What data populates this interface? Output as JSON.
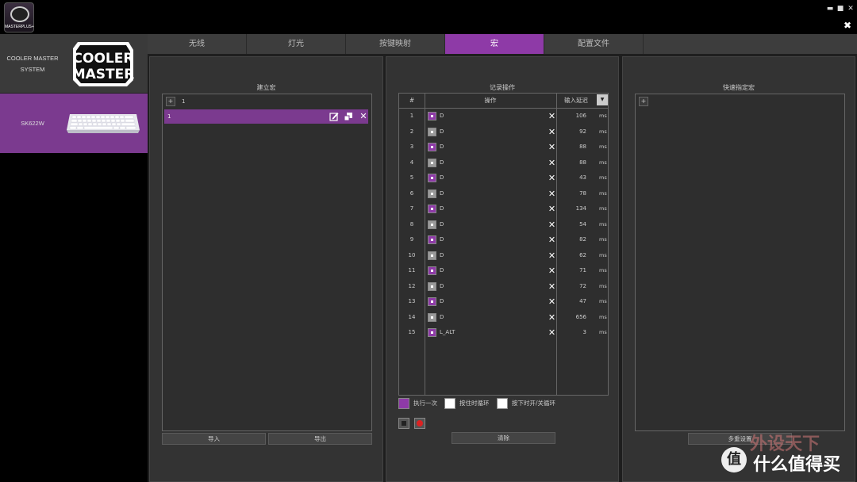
{
  "app": {
    "logo_label": "MASTERPLUS+"
  },
  "window_controls": {
    "minimize": "▬",
    "maximize": "■",
    "close": "✕"
  },
  "sidebar": {
    "devices": [
      {
        "label": "COOLER MASTER SYSTEM",
        "logo_text_1": "COOLER",
        "logo_text_2": "MASTER"
      },
      {
        "label": "SK622W"
      }
    ]
  },
  "tabs": [
    {
      "label": "无线"
    },
    {
      "label": "灯光"
    },
    {
      "label": "按键映射"
    },
    {
      "label": "宏",
      "active": true
    },
    {
      "label": "配置文件"
    }
  ],
  "build_macro": {
    "title": "建立宏",
    "add_label": "+",
    "header_value": "1",
    "macros": [
      {
        "name": "1"
      }
    ],
    "import_label": "导入",
    "export_label": "导出"
  },
  "record": {
    "title": "记录操作",
    "col_num": "#",
    "col_action": "操作",
    "col_delay": "输入延迟",
    "dropdown_icon": "▼",
    "unit": "ms",
    "rows": [
      {
        "n": "1",
        "state": "down",
        "key": "D",
        "delay": "106"
      },
      {
        "n": "2",
        "state": "up",
        "key": "D",
        "delay": "92"
      },
      {
        "n": "3",
        "state": "down",
        "key": "D",
        "delay": "88"
      },
      {
        "n": "4",
        "state": "up",
        "key": "D",
        "delay": "88"
      },
      {
        "n": "5",
        "state": "down",
        "key": "D",
        "delay": "43"
      },
      {
        "n": "6",
        "state": "up",
        "key": "D",
        "delay": "78"
      },
      {
        "n": "7",
        "state": "down",
        "key": "D",
        "delay": "134"
      },
      {
        "n": "8",
        "state": "up",
        "key": "D",
        "delay": "54"
      },
      {
        "n": "9",
        "state": "down",
        "key": "D",
        "delay": "82"
      },
      {
        "n": "10",
        "state": "up",
        "key": "D",
        "delay": "62"
      },
      {
        "n": "11",
        "state": "down",
        "key": "D",
        "delay": "71"
      },
      {
        "n": "12",
        "state": "up",
        "key": "D",
        "delay": "72"
      },
      {
        "n": "13",
        "state": "down",
        "key": "D",
        "delay": "47"
      },
      {
        "n": "14",
        "state": "up",
        "key": "D",
        "delay": "656"
      },
      {
        "n": "15",
        "state": "down",
        "key": "L_ALT",
        "delay": "3"
      }
    ],
    "modes": [
      {
        "label": "执行一次",
        "selected": true
      },
      {
        "label": "按住时循环",
        "selected": false
      },
      {
        "label": "按下时开/关循环",
        "selected": false
      }
    ],
    "clear_label": "清除"
  },
  "quick": {
    "title": "快速指定宏",
    "add_label": "+",
    "button_label": "多重设置"
  },
  "watermark": {
    "line1": "外设天下",
    "line2": "什么值得买",
    "badge": "值"
  },
  "colors": {
    "accent": "#8e3aa7",
    "sidebar_selected": "#7b3a8f"
  }
}
